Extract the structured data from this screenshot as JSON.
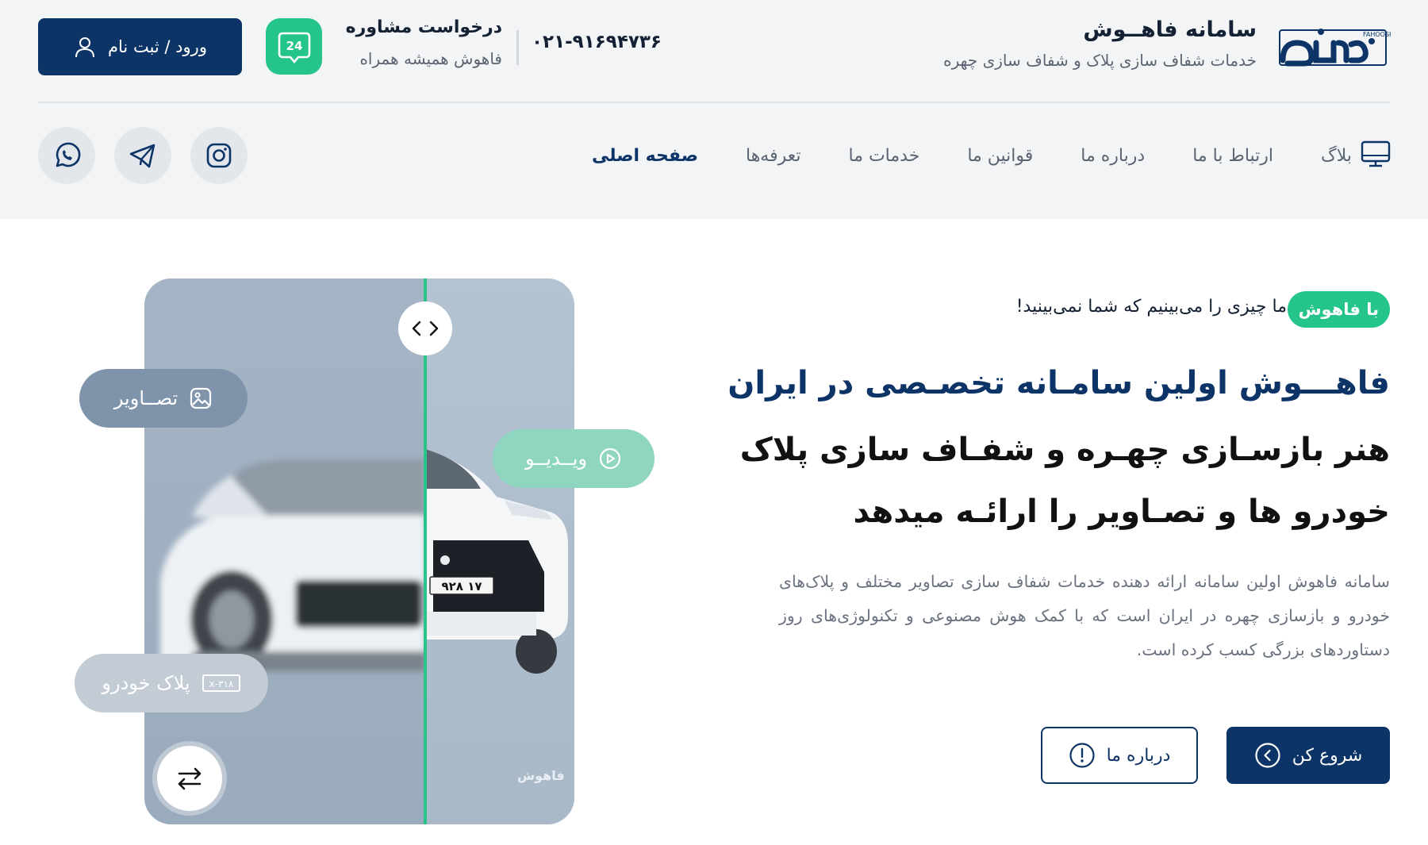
{
  "brand": {
    "title": "سامانه فاهــوش",
    "subtitle": "خدمات شفاف سازی پلاک و شفاف سازی چهره",
    "logo_text": "فاهوش",
    "logo_latin": "FAHOOSH"
  },
  "contact": {
    "phone": "۰۲۱-۹۱۶۹۴۷۳۶",
    "consult_title": "درخواست مشاوره",
    "consult_sub": "فاهوش همیشه همراه",
    "badge": "24"
  },
  "auth": {
    "login_label": "ورود / ثبت نام"
  },
  "nav": {
    "items": [
      {
        "label": "صفحه اصلی",
        "active": true
      },
      {
        "label": "تعرفه‌ها"
      },
      {
        "label": "خدمات ما"
      },
      {
        "label": "قوانین ما"
      },
      {
        "label": "درباره ما"
      },
      {
        "label": "ارتباط با ما"
      },
      {
        "label": "بلاگ"
      }
    ]
  },
  "social": [
    "instagram-icon",
    "telegram-icon",
    "whatsapp-icon"
  ],
  "hero": {
    "tag": "با فاهوش",
    "tag_line": "ما چیزی را می‌بینیم که شما نمی‌بینید!",
    "headline_1": "فاهـــوش اولین سامـانه تخصـصی در ایران",
    "headline_2": "هنر بازسـازی چهـره و شفـاف سازی پلاک",
    "headline_3": "خودرو ها و تصـاویر را ارائـه میدهد",
    "description": "سامانه فاهوش اولین سامانه ارائه دهنده خدمات شفاف سازی تصاویر مختلف و پلاک‌های خودرو و بازسازی چهره در ایران است که با کمک هوش مصنوعی و تکنولوژی‌های روز دستاوردهای بزرگی کسب کرده است.",
    "start_label": "شروع کن",
    "about_label": "درباره ما"
  },
  "showcase": {
    "pill_images": "تصــاویر",
    "pill_video": "ویــدیــو",
    "pill_plate": "پلاک خودرو",
    "plate_icon_text": "x-۳۱۸",
    "plate_number": "۹۲۸ ۱۷",
    "watermark": "فاهوش"
  },
  "colors": {
    "primary": "#0d3466",
    "accent": "#25c48a"
  }
}
